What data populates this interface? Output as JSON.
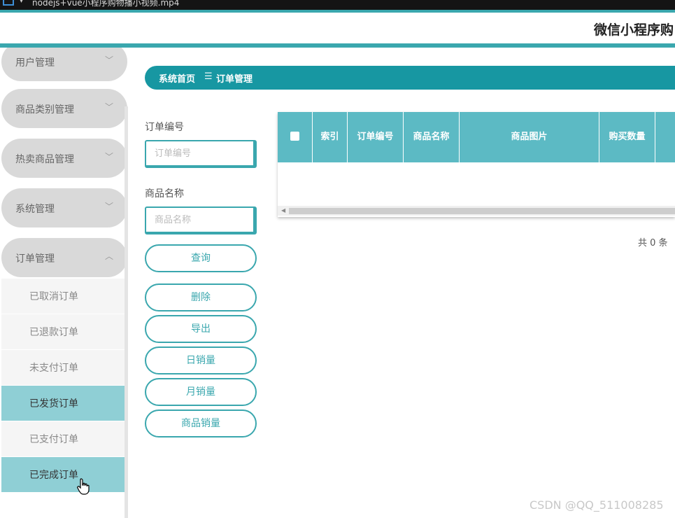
{
  "window": {
    "video_title": "nodejs+vue小程序购物播小视频.mp4"
  },
  "header": {
    "app_title": "微信小程序购"
  },
  "sidebar": {
    "menus": [
      {
        "label": "用户管理",
        "expanded": false
      },
      {
        "label": "商品类别管理",
        "expanded": false
      },
      {
        "label": "热卖商品管理",
        "expanded": false
      },
      {
        "label": "系统管理",
        "expanded": false
      },
      {
        "label": "订单管理",
        "expanded": true
      }
    ],
    "sub_items": [
      {
        "label": "已取消订单",
        "active": false
      },
      {
        "label": "已退款订单",
        "active": false
      },
      {
        "label": "未支付订单",
        "active": false
      },
      {
        "label": "已发货订单",
        "active": true
      },
      {
        "label": "已支付订单",
        "active": false
      },
      {
        "label": "已完成订单",
        "active": true
      }
    ]
  },
  "breadcrumb": {
    "home": "系统首页",
    "separator": "☰",
    "current": "订单管理"
  },
  "search": {
    "order_no_label": "订单编号",
    "order_no_placeholder": "订单编号",
    "order_no_value": "",
    "product_name_label": "商品名称",
    "product_name_placeholder": "商品名称",
    "product_name_value": ""
  },
  "buttons": {
    "query": "查询",
    "delete": "删除",
    "export": "导出",
    "daily_sales": "日销量",
    "monthly_sales": "月销量",
    "product_sales": "商品销量"
  },
  "table": {
    "columns": [
      "索引",
      "订单编号",
      "商品名称",
      "商品图片",
      "购买数量"
    ],
    "rows": []
  },
  "pagination": {
    "total_text": "共 0 条"
  },
  "watermark": "CSDN @QQ_511008285",
  "colors": {
    "accent": "#3aa7ae",
    "breadcrumb_bg": "#1797a2",
    "table_header": "#5cbac4",
    "active_item": "#8fcfd5",
    "menu_pill": "#d9d9d9"
  }
}
